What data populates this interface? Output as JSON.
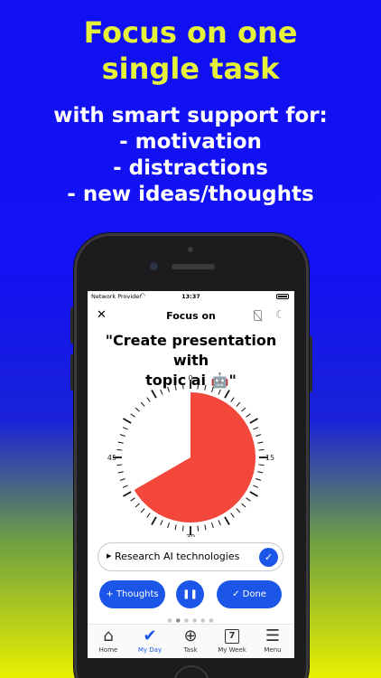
{
  "promo": {
    "headline_line1": "Focus on one",
    "headline_line2": "single task",
    "sub_line1": "with smart support for:",
    "sub_line2": "- motivation",
    "sub_line3": "- distractions",
    "sub_line4": "- new ideas/thoughts"
  },
  "status_bar": {
    "provider": "Network Provider",
    "time": "13:37"
  },
  "nav": {
    "close_icon": "close-icon",
    "title": "Focus on",
    "phone_off_icon": "phone-off-icon",
    "moon_icon": "moon-icon"
  },
  "task": {
    "title_line1": "\"Create presentation with",
    "title_line2": "topic ai 🤖\""
  },
  "timer": {
    "labels": {
      "top": "0",
      "right": "15",
      "bottom": "30",
      "left": "45"
    },
    "remaining_minutes": 40,
    "total_minutes": 60,
    "fill_color": "#f4473b"
  },
  "subtask": {
    "text": "Research AI technologies",
    "expand_icon": "triangle-right-icon",
    "check_icon": "checkmark-icon"
  },
  "actions": {
    "thoughts_label": "Thoughts",
    "done_label": "Done"
  },
  "tabbar": {
    "items": [
      {
        "label": "Home",
        "icon": "home-icon"
      },
      {
        "label": "My Day",
        "icon": "checkmarks-icon",
        "active": true
      },
      {
        "label": "Task",
        "icon": "plus-circle-icon"
      },
      {
        "label": "My Week",
        "icon": "calendar-icon",
        "day": "7"
      },
      {
        "label": "Menu",
        "icon": "hamburger-icon"
      }
    ]
  },
  "colors": {
    "accent": "#1c56e8",
    "headline_yellow": "#e6f23a",
    "timer_red": "#f4473b"
  }
}
